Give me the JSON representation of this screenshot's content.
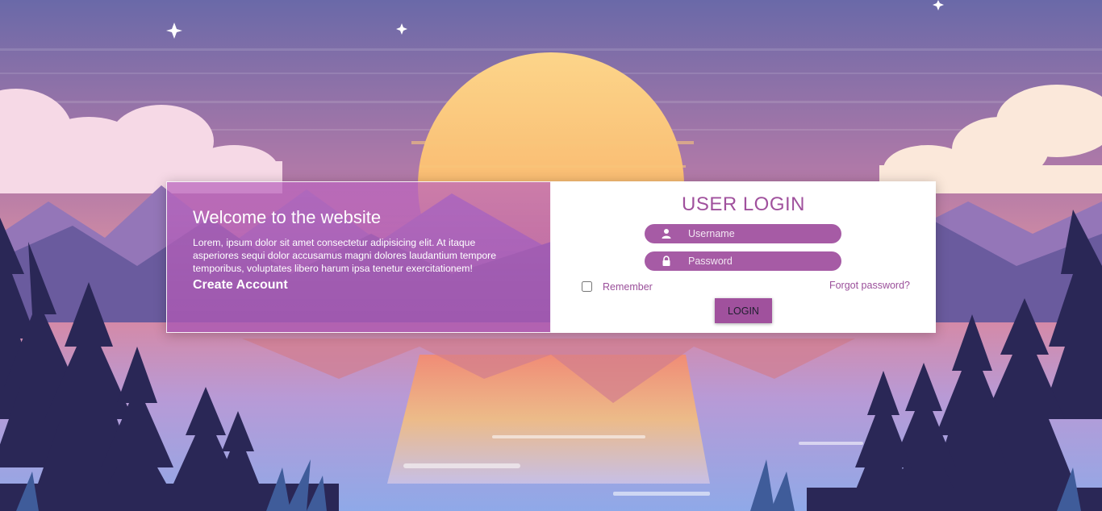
{
  "welcome": {
    "title": "Welcome to the website",
    "text": "Lorem, ipsum dolor sit amet consectetur adipisicing elit. At itaque asperiores sequi dolor accusamus magni dolores laudantium tempore temporibus, voluptates libero harum ipsa tenetur exercitationem!",
    "create_account": "Create Account"
  },
  "login": {
    "title": "USER LOGIN",
    "username_placeholder": "Username",
    "password_placeholder": "Password",
    "remember_label": "Remember",
    "forgot_label": "Forgot password?",
    "button_label": "LOGIN",
    "icons": {
      "username": "user-icon",
      "password": "lock-icon"
    }
  },
  "colors": {
    "accent": "#a65ba5",
    "title": "#a0519d"
  }
}
